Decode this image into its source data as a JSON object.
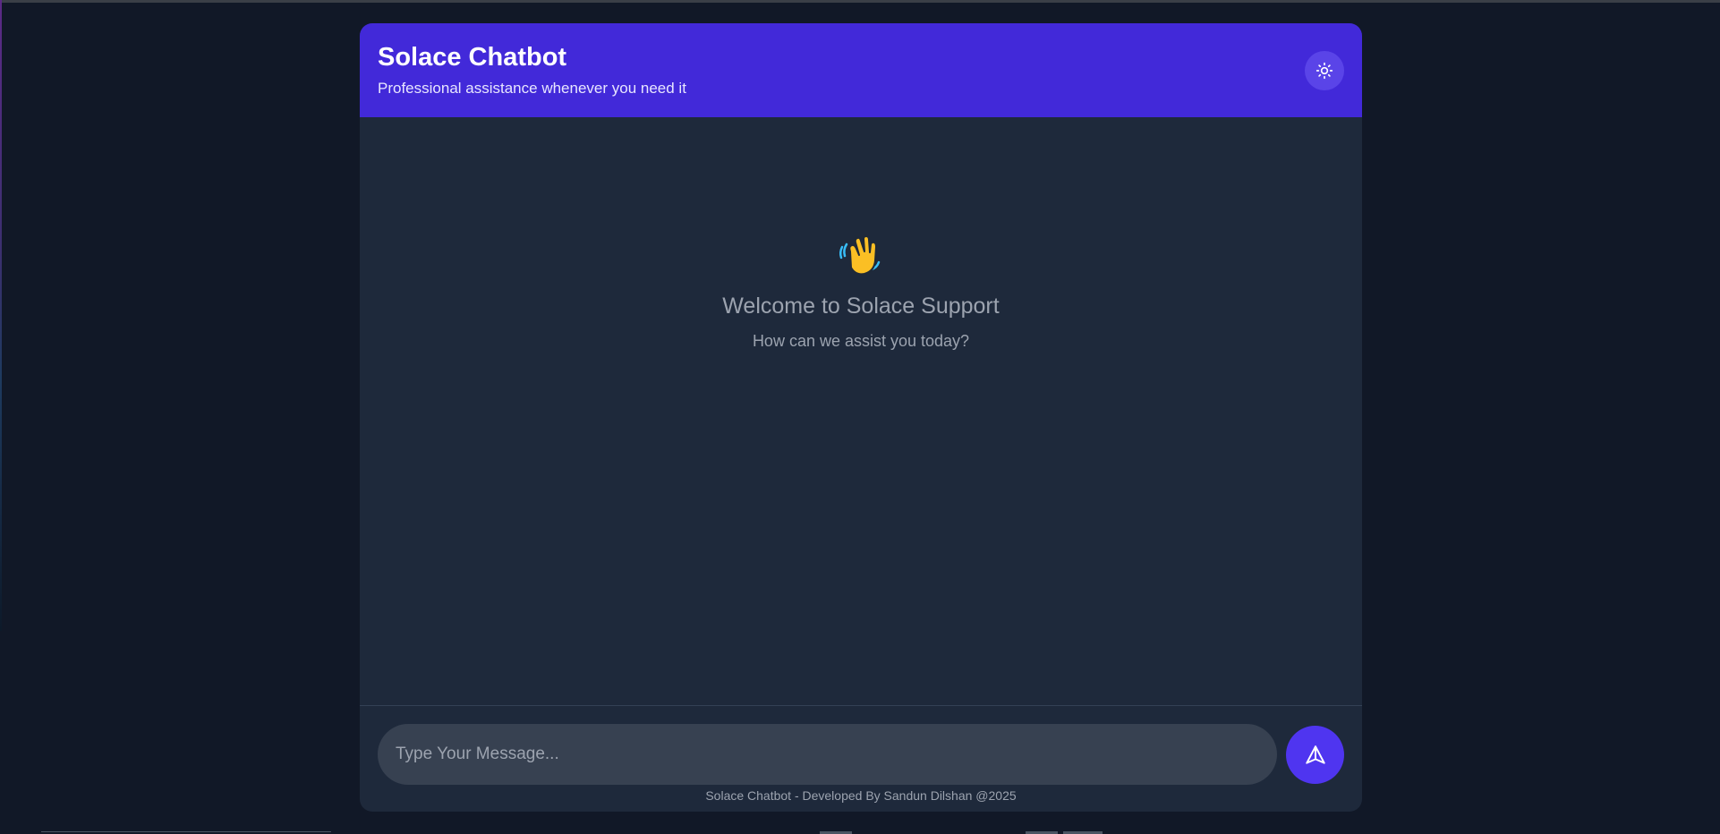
{
  "header": {
    "title": "Solace Chatbot",
    "subtitle": "Professional assistance whenever you need it",
    "theme_toggle_icon": "sun-icon"
  },
  "welcome": {
    "icon": "waving-hand-icon",
    "title": "Welcome to Solace Support",
    "subtitle": "How can we assist you today?"
  },
  "composer": {
    "value": "",
    "placeholder": "Type Your Message...",
    "send_icon": "send-icon"
  },
  "footer": {
    "text": "Solace Chatbot - Developed By Sandun Dilshan @2025"
  },
  "colors": {
    "background": "#111827",
    "card": "#1e293b",
    "header": "#4229d9",
    "accent": "#4f35f0",
    "input": "#374151",
    "muted_text": "#9ca3af"
  }
}
